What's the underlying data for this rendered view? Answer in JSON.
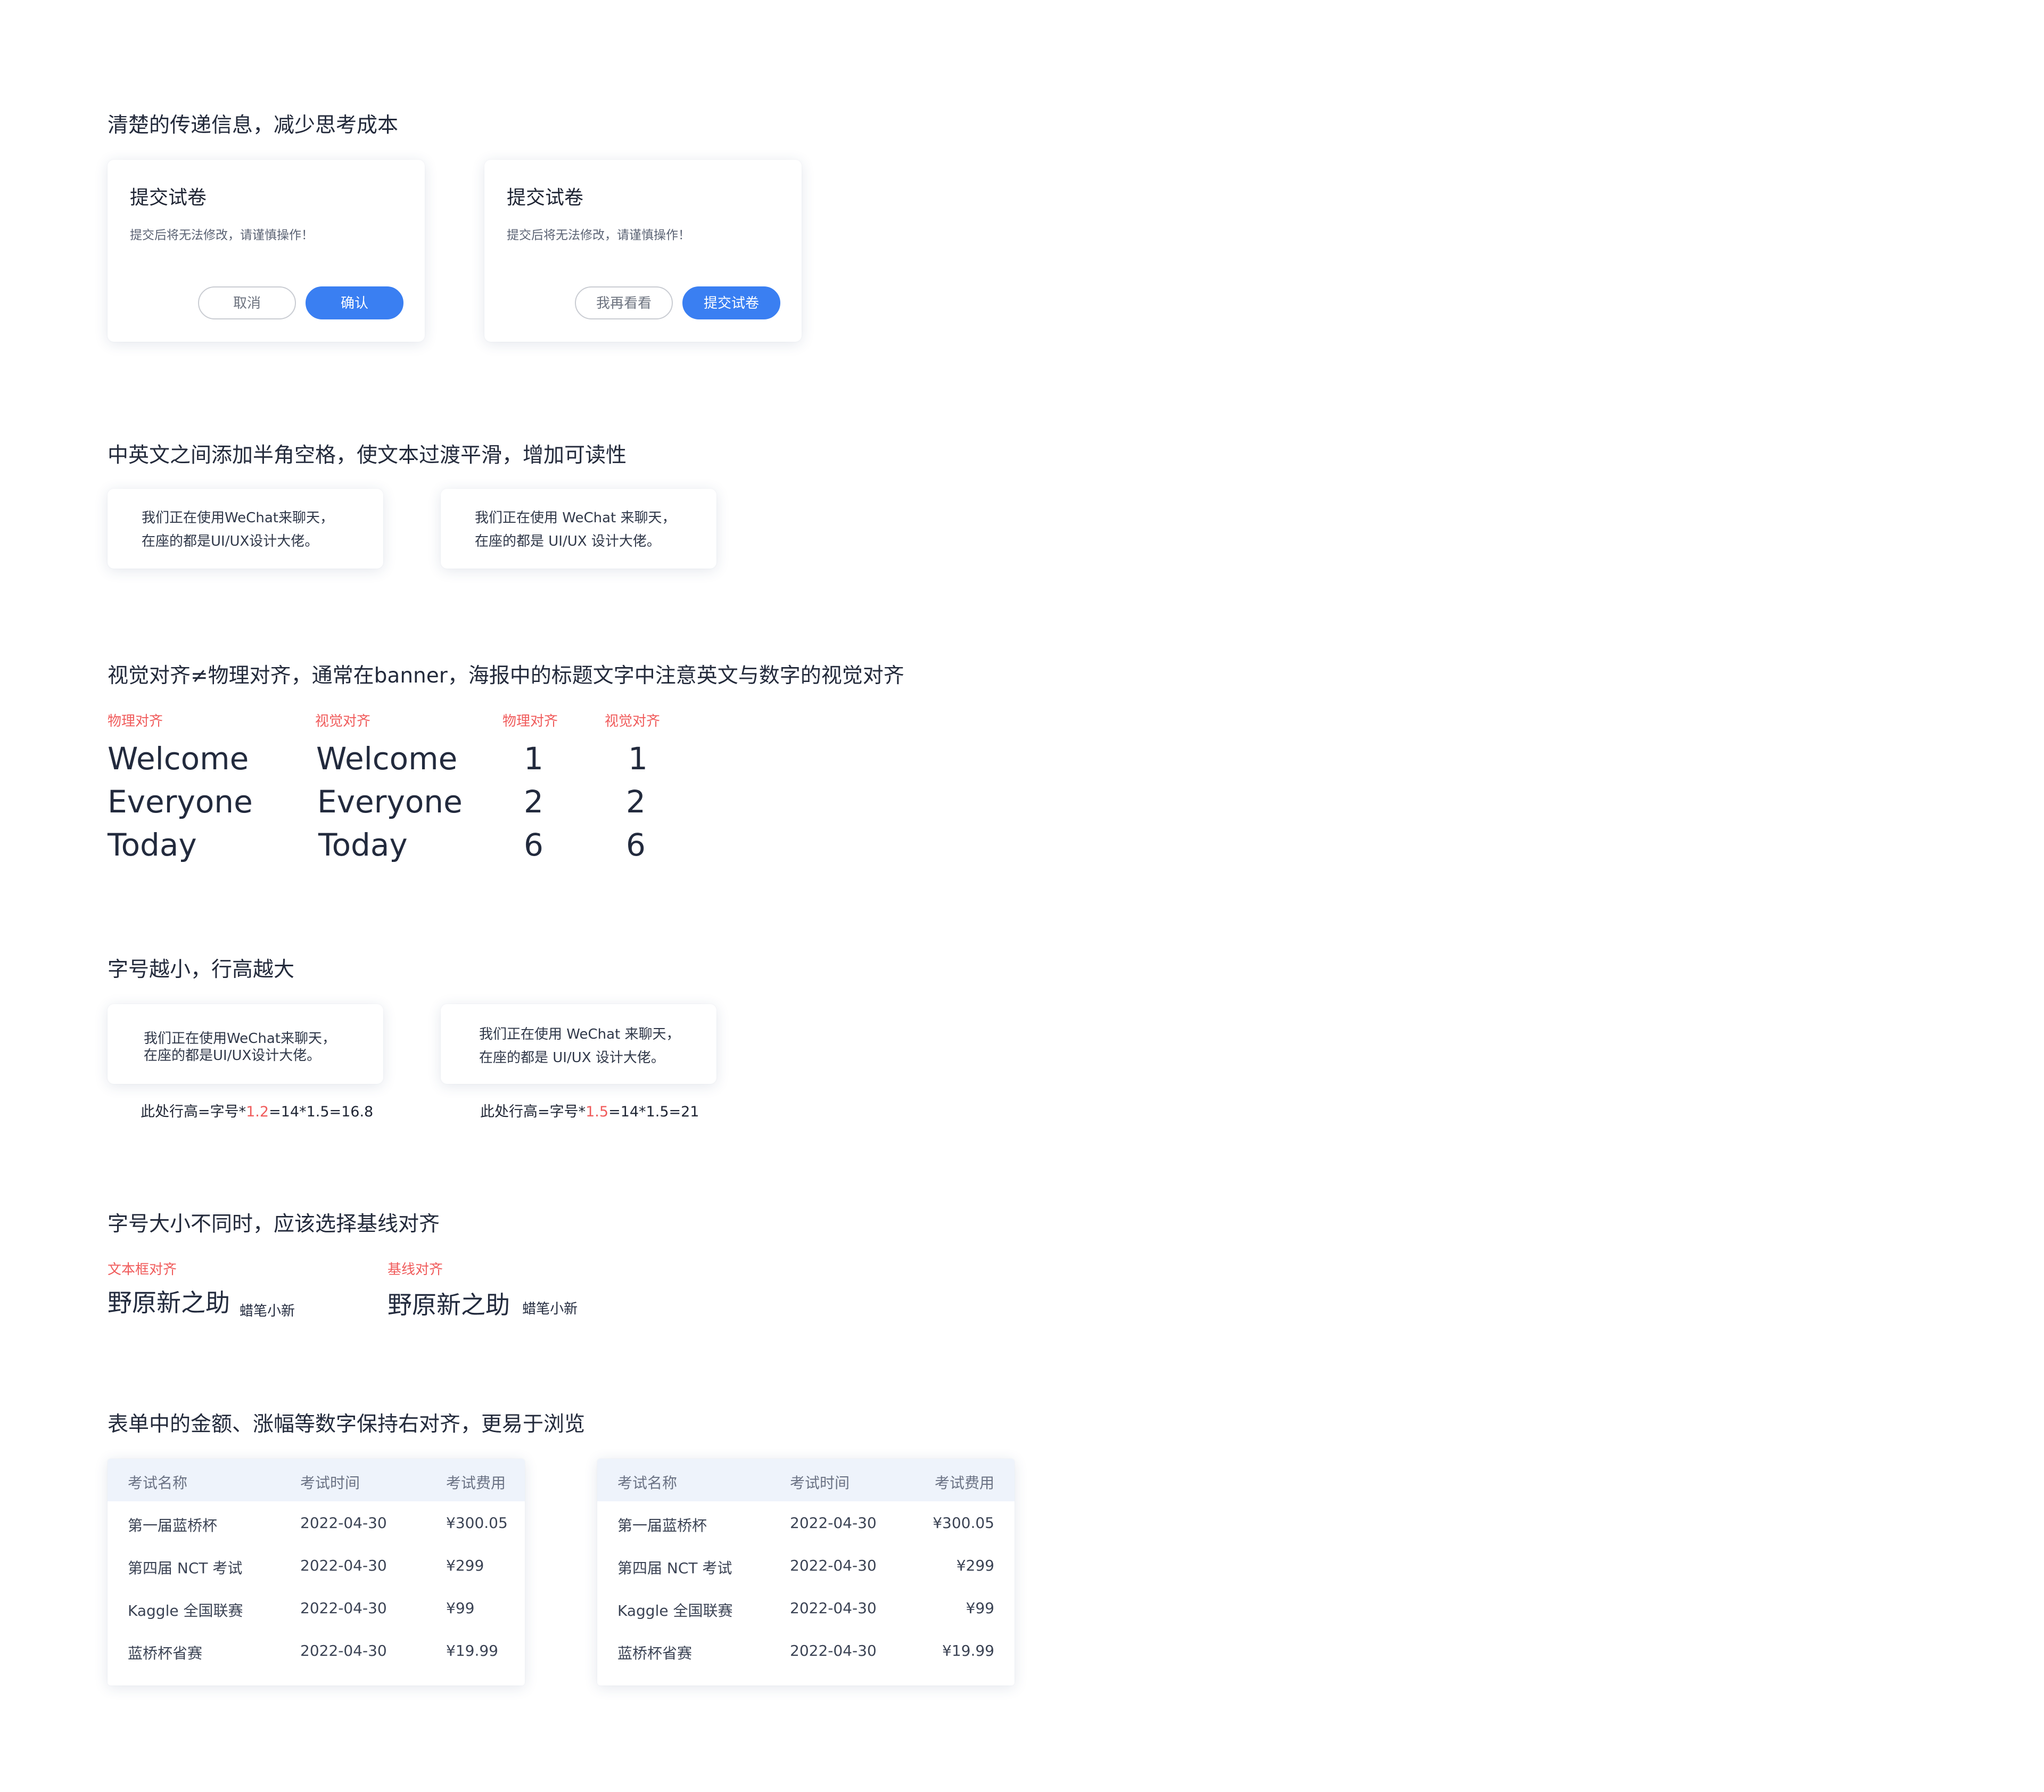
{
  "sections": {
    "s1": {
      "heading": "清楚的传递信息，减少思考成本",
      "dialogs": [
        {
          "title": "提交试卷",
          "message": "提交后将无法修改，请谨慎操作！",
          "secondary": "取消",
          "primary": "确认"
        },
        {
          "title": "提交试卷",
          "message": "提交后将无法修改，请谨慎操作！",
          "secondary": "我再看看",
          "primary": "提交试卷"
        }
      ]
    },
    "s2": {
      "heading": "中英文之间添加半角空格，使文本过渡平滑，增加可读性",
      "cards": [
        {
          "line1": "我们正在使用WeChat来聊天，",
          "line2": "在座的都是UI/UX设计大佬。"
        },
        {
          "line1": "我们正在使用 WeChat 来聊天，",
          "line2": "在座的都是 UI/UX 设计大佬。"
        }
      ]
    },
    "s3": {
      "heading": "视觉对齐≠物理对齐，通常在banner，海报中的标题文字中注意英文与数字的视觉对齐",
      "labels": [
        "物理对齐",
        "视觉对齐",
        "物理对齐",
        "视觉对齐"
      ],
      "words": [
        "Welcome",
        "Everyone",
        "Today"
      ],
      "numbers": [
        "1",
        "2",
        "6"
      ]
    },
    "s4": {
      "heading": "字号越小，行高越大",
      "cards": [
        {
          "line1": "我们正在使用WeChat来聊天，",
          "line2": "在座的都是UI/UX设计大佬。"
        },
        {
          "line1": "我们正在使用 WeChat 来聊天，",
          "line2": "在座的都是 UI/UX 设计大佬。"
        }
      ],
      "formulas": [
        {
          "prefix": "此处行高=字号*",
          "factor": "1.2",
          "suffix": "=14*1.5=16.8"
        },
        {
          "prefix": "此处行高=字号*",
          "factor": "1.5",
          "suffix": "=14*1.5=21"
        }
      ]
    },
    "s5": {
      "heading": "字号大小不同时，应该选择基线对齐",
      "labels": [
        "文本框对齐",
        "基线对齐"
      ],
      "name_big": "野原新之助",
      "name_small": "蜡笔小新"
    },
    "s6": {
      "heading": "表单中的金额、涨幅等数字保持右对齐，更易于浏览",
      "columns": [
        "考试名称",
        "考试时间",
        "考试费用"
      ],
      "rows": [
        {
          "name": "第一届蓝桥杯",
          "date": "2022-04-30",
          "fee": "¥300.05"
        },
        {
          "name": "第四届 NCT 考试",
          "date": "2022-04-30",
          "fee": "¥299"
        },
        {
          "name": "Kaggle 全国联赛",
          "date": "2022-04-30",
          "fee": "¥99"
        },
        {
          "name": "蓝桥杯省赛",
          "date": "2022-04-30",
          "fee": "¥19.99"
        }
      ]
    }
  },
  "colors": {
    "accent": "#3a7ff2",
    "highlight": "#f05b5b",
    "table_header_bg": "#eef3fb"
  }
}
